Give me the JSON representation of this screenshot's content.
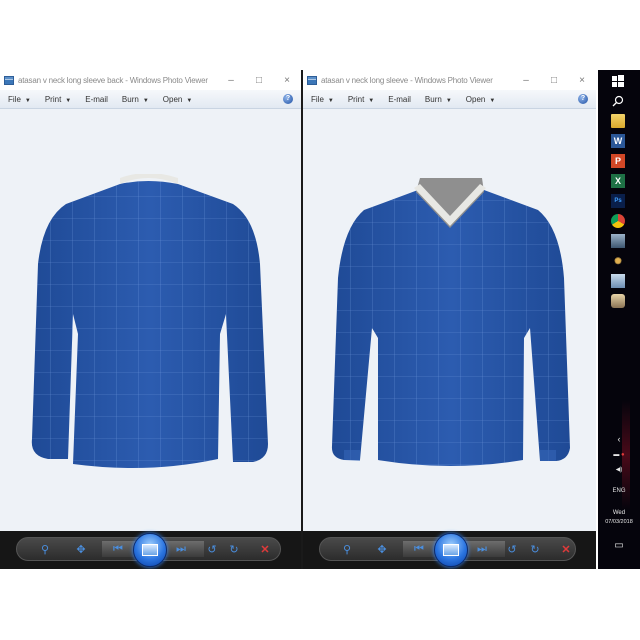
{
  "windows": [
    {
      "title": "atasan v neck long sleeve back - Windows Photo Viewer",
      "controls": {
        "minimize": "–",
        "maximize": "□",
        "close": "×"
      },
      "menu": [
        {
          "label": "File",
          "has_dropdown": true
        },
        {
          "label": "Print",
          "has_dropdown": true
        },
        {
          "label": "E-mail",
          "has_dropdown": false
        },
        {
          "label": "Burn",
          "has_dropdown": true
        },
        {
          "label": "Open",
          "has_dropdown": true
        }
      ],
      "help_icon": "?",
      "image": {
        "subject": "Blue long sleeve shirt with white grid pattern, back view",
        "shirt_color": "#2a57a8",
        "collar_color": "#e8e8e4",
        "grid_color": "#7ea6e6"
      },
      "toolbar": [
        "zoom-icon",
        "fit-window-icon",
        "previous-icon",
        "slideshow-icon",
        "next-icon",
        "rotate-ccw-icon",
        "rotate-cw-icon",
        "delete-icon"
      ]
    },
    {
      "title": "atasan v neck long sleeve - Windows Photo Viewer",
      "controls": {
        "minimize": "–",
        "maximize": "□",
        "close": "×"
      },
      "menu": [
        {
          "label": "File",
          "has_dropdown": true
        },
        {
          "label": "Print",
          "has_dropdown": true
        },
        {
          "label": "E-mail",
          "has_dropdown": false
        },
        {
          "label": "Burn",
          "has_dropdown": true
        },
        {
          "label": "Open",
          "has_dropdown": true
        }
      ],
      "help_icon": "?",
      "image": {
        "subject": "Blue V-neck long sleeve shirt with white grid pattern, front view",
        "shirt_color": "#2a57a8",
        "collar_color": "#e8e8e4",
        "grid_color": "#7ea6e6"
      },
      "toolbar": [
        "zoom-icon",
        "fit-window-icon",
        "previous-icon",
        "slideshow-icon",
        "next-icon",
        "rotate-ccw-icon",
        "rotate-cw-icon",
        "delete-icon"
      ]
    }
  ],
  "glyphs": {
    "dropdown": "▼",
    "zoom": "⚲",
    "fit": "✥",
    "prev": "⏮",
    "next": "⏭",
    "rotate_ccw": "↺",
    "rotate_cw": "↻",
    "delete": "✕"
  },
  "taskbar": {
    "icons": [
      "windows-start-icon",
      "search-icon",
      "file-explorer-icon",
      "word-icon",
      "powerpoint-icon",
      "excel-icon",
      "photoshop-icon",
      "chrome-icon",
      "photos-icon",
      "app-icon",
      "photo-viewer-icon",
      "media-icon"
    ],
    "icon_letters": {
      "word": "W",
      "powerpoint": "P",
      "excel": "X",
      "photoshop": "Ps"
    },
    "chevron": "‹",
    "language": "ENG",
    "day": "Wed",
    "date": "07/03/2018",
    "notification_icon": "▭"
  }
}
